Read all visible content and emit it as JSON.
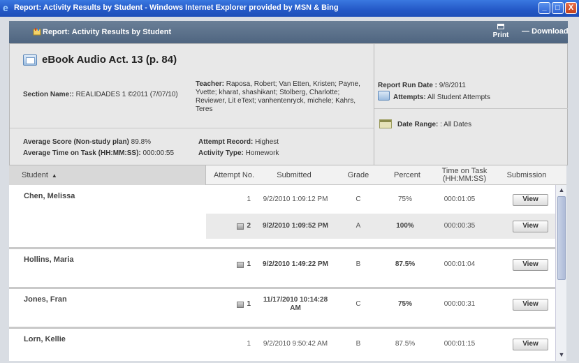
{
  "window": {
    "title": "Report: Activity Results by Student - Windows Internet Explorer provided by MSN & Bing",
    "min_glyph": "_",
    "max_glyph": "□",
    "close_glyph": "X"
  },
  "report_bar": {
    "title": "Report: Activity Results by Student",
    "print_label": "Print",
    "download_label": "Download",
    "download_prefix": "—"
  },
  "info": {
    "activity_title": "eBook Audio Act. 13 (p. 84)",
    "section_label": "Section Name::",
    "section_value": "REALIDADES 1 ©2011 (7/07/10)",
    "teacher_label": "Teacher:",
    "teacher_value": "Raposa, Robert; Van Etten, Kristen; Payne, Yvette; kharat, shashikant; Stolberg, Charlotte; Reviewer, Lit eText; vanhentenryck, michele; Kahrs, Teres",
    "avg_score_label": "Average Score (Non-study plan)",
    "avg_score_value": "89.8%",
    "avg_time_label": "Average Time on Task (HH:MM:SS):",
    "avg_time_value": "000:00:55",
    "attempt_record_label": "Attempt Record:",
    "attempt_record_value": "Highest",
    "activity_type_label": "Activity Type:",
    "activity_type_value": "Homework",
    "run_date_label": "Report Run Date :",
    "run_date_value": "9/8/2011",
    "attempts_label": "Attempts:",
    "attempts_value": "All Student Attempts",
    "date_range_label": "Date Range:",
    "date_range_value": ": All Dates"
  },
  "table": {
    "headers": {
      "student": "Student",
      "sort_indicator": "▲",
      "attempt": "Attempt No.",
      "submitted": "Submitted",
      "grade": "Grade",
      "percent": "Percent",
      "time": "Time on Task (HH:MM:SS)",
      "submission": "Submission"
    },
    "view_label": "View",
    "students": [
      {
        "name": "Chen, Melissa",
        "rows": [
          {
            "attempt": "1",
            "submitted": "9/2/2010 1:09:12 PM",
            "grade": "C",
            "percent": "75%",
            "time": "000:01:05"
          },
          {
            "attempt": "2",
            "submitted": "9/2/2010 1:09:52 PM",
            "grade": "A",
            "percent": "100%",
            "time": "000:00:35"
          }
        ]
      },
      {
        "name": "Hollins, Maria",
        "rows": [
          {
            "attempt": "1",
            "submitted": "9/2/2010 1:49:22 PM",
            "grade": "B",
            "percent": "87.5%",
            "time": "000:01:04"
          }
        ]
      },
      {
        "name": "Jones, Fran",
        "rows": [
          {
            "attempt": "1",
            "submitted": "11/17/2010 10:14:28 AM",
            "grade": "C",
            "percent": "75%",
            "time": "000:00:31"
          }
        ]
      },
      {
        "name": "Lorn, Kellie",
        "rows": [
          {
            "attempt": "1",
            "submitted": "9/2/2010 9:50:42 AM",
            "grade": "B",
            "percent": "87.5%",
            "time": "000:01:15"
          }
        ]
      }
    ]
  },
  "scrollbar": {
    "up": "▲",
    "down": "▼"
  }
}
